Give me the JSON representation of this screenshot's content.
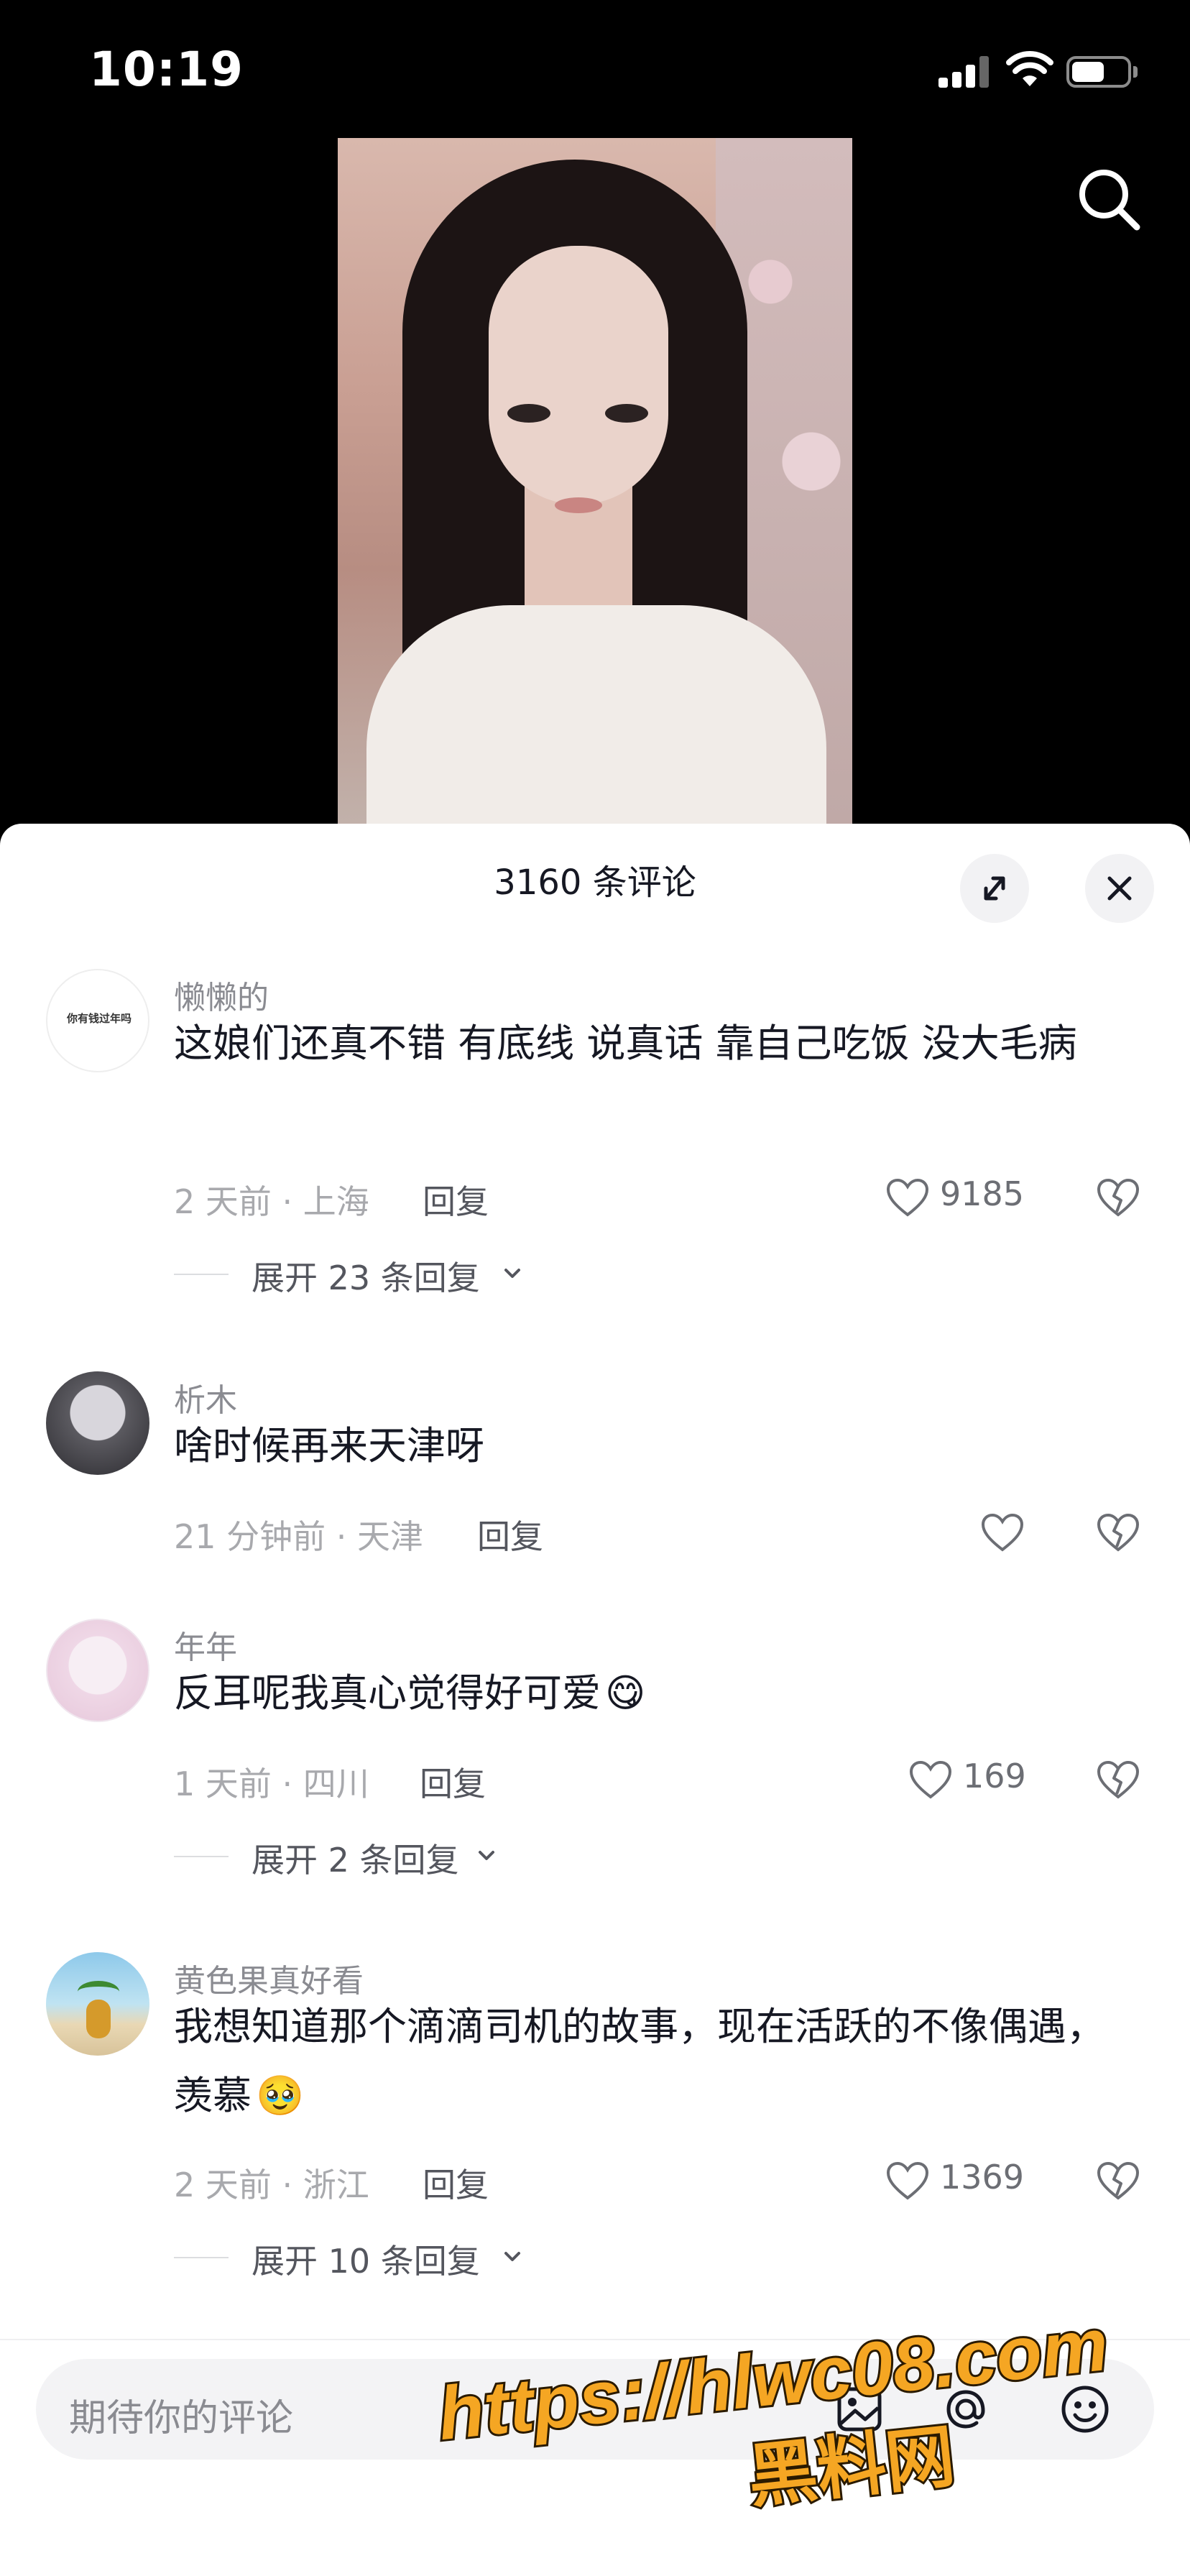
{
  "status_bar": {
    "time": "10:19"
  },
  "header": {
    "comment_count_title": "3160 条评论"
  },
  "comments": [
    {
      "username": "懒懒的",
      "avatar_text": "你有钱过年吗",
      "text": "这娘们还真不错 有底线 说真话 靠自己吃饭 没大毛病",
      "meta": "2 天前 · 上海",
      "reply_label": "回复",
      "likes": "9185",
      "expand_label": "展开 23 条回复"
    },
    {
      "username": "析木",
      "text": "啥时候再来天津呀",
      "meta": "21 分钟前 · 天津",
      "reply_label": "回复"
    },
    {
      "username": "年年",
      "text": "反耳呢我真心觉得好可爱",
      "emoji": "😋",
      "meta": "1 天前 · 四川",
      "reply_label": "回复",
      "likes": "169",
      "expand_label": "展开 2 条回复"
    },
    {
      "username": "黄色果真好看",
      "text": "我想知道那个滴滴司机的故事，现在活跃的不像偶遇，羡慕",
      "emoji": "🥹",
      "meta": "2 天前 · 浙江",
      "reply_label": "回复",
      "likes": "1369",
      "expand_label": "展开 10 条回复"
    }
  ],
  "input": {
    "placeholder": "期待你的评论"
  },
  "watermark": {
    "line1": "https://hlwc08.com",
    "line2": "黑料网"
  },
  "colors": {
    "sheet_bg": "#ffffff",
    "text": "#161823",
    "muted": "#a8a9ad",
    "watermark_fill": "#f5a623"
  }
}
